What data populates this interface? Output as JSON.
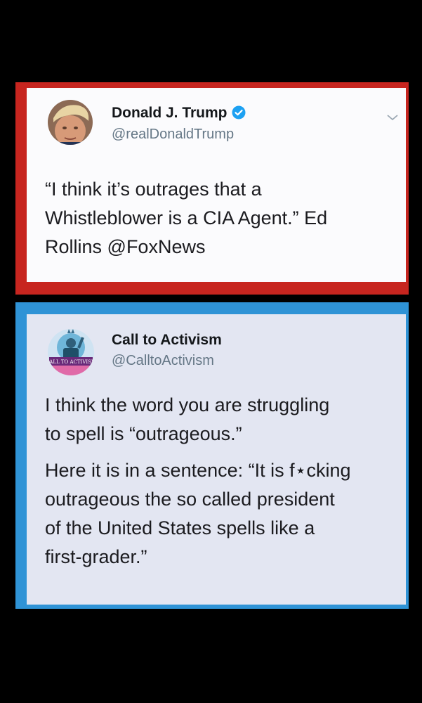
{
  "tweet_trump": {
    "display_name": "Donald J. Trump",
    "handle": "@realDonaldTrump",
    "verified": true,
    "text_lines": [
      "“I think it’s outrages that a",
      "Whistleblower is a CIA Agent.” Ed",
      "Rollins "
    ],
    "mention": "@FoxNews",
    "border_color": "#c7251f"
  },
  "tweet_activism": {
    "display_name": "Call to Activism",
    "handle": "@CalltoActivism",
    "avatar_banner_text": "CALL TO ACTIVISM",
    "paragraph1_lines": [
      "I think the word you are struggling",
      "to spell is “outrageous.”"
    ],
    "paragraph2_lines": [
      "Here it is in a sentence: “It is f⋆cking",
      "outrageous the so called president",
      "of the United States spells like a",
      "first-grader.”"
    ],
    "border_color": "#2f93d6"
  },
  "icons": {
    "verified": "verified-badge-icon",
    "more": "chevron-down-icon"
  }
}
